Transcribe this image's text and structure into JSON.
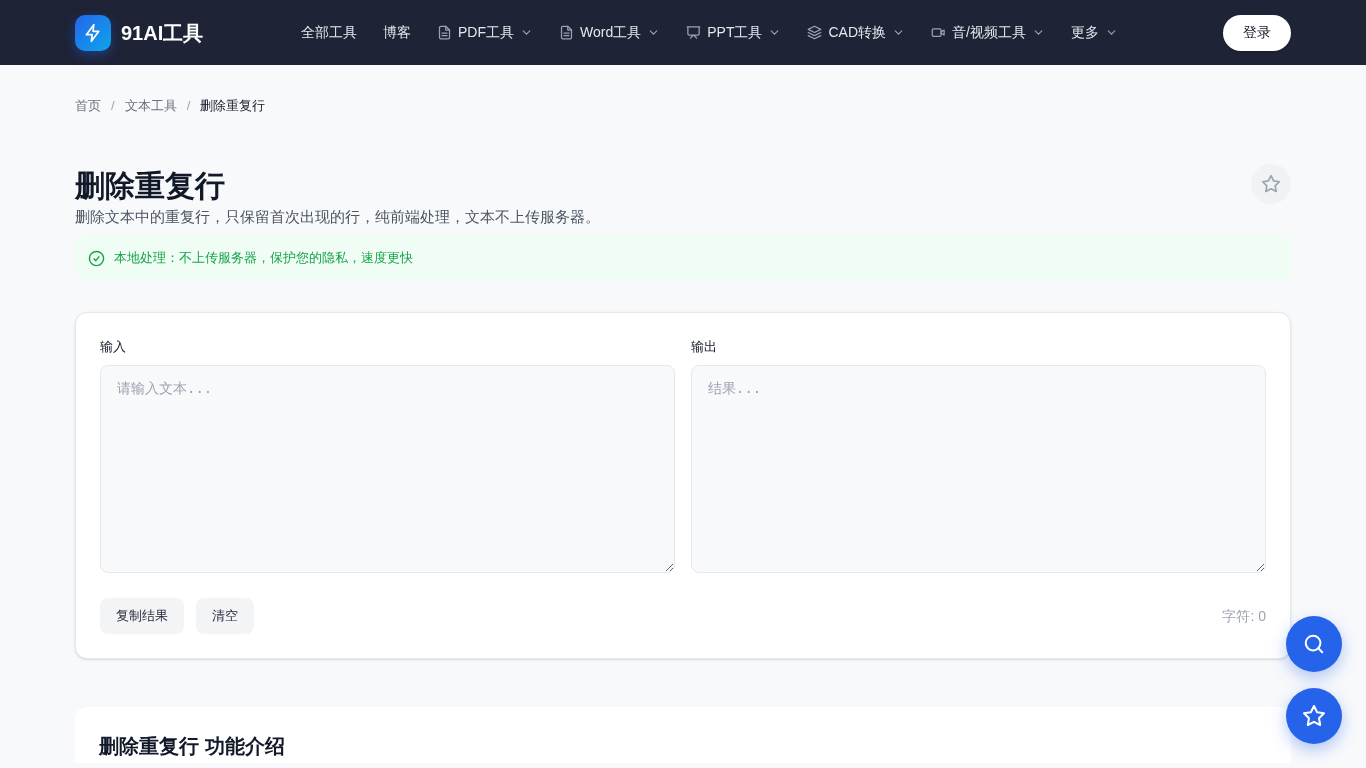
{
  "logo": {
    "text": "91AI工具"
  },
  "nav": [
    {
      "label": "全部工具",
      "kind": "plain",
      "dropdown": false
    },
    {
      "label": "博客",
      "kind": "plain",
      "dropdown": false
    },
    {
      "label": "PDF工具",
      "kind": "document",
      "dropdown": true
    },
    {
      "label": "Word工具",
      "kind": "document",
      "dropdown": true
    },
    {
      "label": "PPT工具",
      "kind": "presentation",
      "dropdown": true
    },
    {
      "label": "CAD转换",
      "kind": "layers",
      "dropdown": true
    },
    {
      "label": "音/视频工具",
      "kind": "video",
      "dropdown": true
    },
    {
      "label": "更多",
      "kind": "plain",
      "dropdown": true
    }
  ],
  "login_button": "登录",
  "breadcrumb": [
    {
      "kind": "link",
      "label": "首页",
      "current": false
    },
    {
      "kind": "separator",
      "label": "/"
    },
    {
      "kind": "link",
      "label": "文本工具",
      "current": false
    },
    {
      "kind": "separator",
      "label": "/"
    },
    {
      "kind": "link",
      "label": "删除重复行",
      "current": true
    }
  ],
  "title": "删除重复行",
  "favorited": false,
  "description": "删除文本中的重复行，只保留首次出现的行，纯前端处理，文本不上传服务器。",
  "notice": "本地处理：不上传服务器，保护您的隐私，速度更快",
  "input": {
    "label": "输入",
    "placeholder": "请输入文本..."
  },
  "output": {
    "label": "输出",
    "placeholder": "结果..."
  },
  "buttons": [
    "复制结果",
    "清空"
  ],
  "char_count": "字符: 0",
  "intro_title": "删除重复行 功能介绍"
}
